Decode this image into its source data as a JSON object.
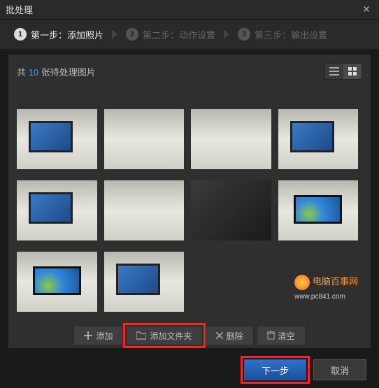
{
  "title": "批处理",
  "steps": [
    {
      "num": "1",
      "label": "第一步：添加照片",
      "active": true
    },
    {
      "num": "2",
      "label": "第二步：动作设置",
      "active": false
    },
    {
      "num": "3",
      "label": "第三步：输出设置",
      "active": false
    }
  ],
  "count": {
    "prefix": "共 ",
    "value": "10",
    "suffix": " 张待处理图片"
  },
  "thumbs": [
    {
      "cls": "desk monitor"
    },
    {
      "cls": "desk"
    },
    {
      "cls": "desk"
    },
    {
      "cls": "desk monitor"
    },
    {
      "cls": "desk monitor"
    },
    {
      "cls": "desk"
    },
    {
      "cls": "dark"
    },
    {
      "cls": "desk win"
    },
    {
      "cls": "desk win"
    },
    {
      "cls": "desk monitor"
    }
  ],
  "toolbar": {
    "add": "添加",
    "add_folder": "添加文件夹",
    "remove": "删除",
    "clear": "清空"
  },
  "footer": {
    "next": "下一步",
    "cancel": "取消"
  },
  "watermark": {
    "text": "电脑百事网",
    "url": "www.pc841.com"
  }
}
